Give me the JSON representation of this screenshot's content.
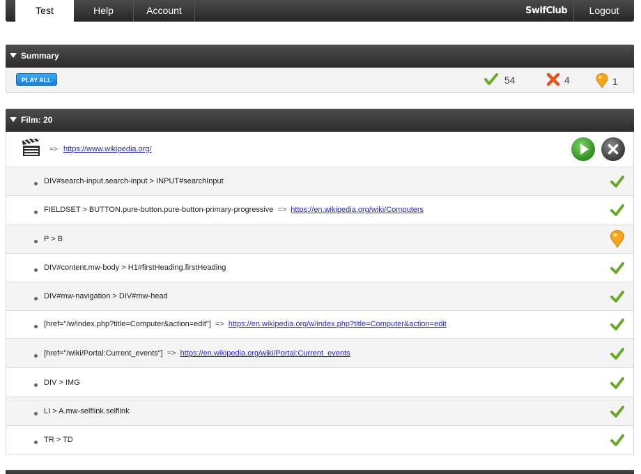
{
  "nav": {
    "tabs": [
      {
        "label": "Test",
        "active": true
      },
      {
        "label": "Help",
        "active": false
      },
      {
        "label": "Account",
        "active": false
      }
    ],
    "brand": "SwifClub",
    "logout": "Logout"
  },
  "summary": {
    "title": "Summary",
    "play_all": "PLAY ALL",
    "passed": "54",
    "failed": "4",
    "warnings": "1"
  },
  "film": {
    "title": "Film: 20",
    "arrow": "=>",
    "url": "https://www.wikipedia.org/",
    "steps": [
      {
        "selector": "DIV#search-input.search-input > INPUT#searchInput",
        "arrow": "",
        "link": "",
        "status": "pass"
      },
      {
        "selector": "FIELDSET > BUTTON.pure-button.pure-button-primary-progressive",
        "arrow": "=>",
        "link": "https://en.wikipedia.org/wiki/Computers",
        "status": "pass"
      },
      {
        "selector": "P > B",
        "arrow": "",
        "link": "",
        "status": "warning"
      },
      {
        "selector": "DIV#content.mw-body > H1#firstHeading.firstHeading",
        "arrow": "",
        "link": "",
        "status": "pass"
      },
      {
        "selector": "DIV#mw-navigation > DIV#mw-head",
        "arrow": "",
        "link": "",
        "status": "pass"
      },
      {
        "selector": "[href=\"/w/index.php?title=Computer&action=edit\"]",
        "arrow": "=>",
        "link": "https://en.wikipedia.org/w/index.php?title=Computer&action=edit",
        "status": "pass"
      },
      {
        "selector": "[href=\"/wiki/Portal:Current_events\"]",
        "arrow": "=>",
        "link": "https://en.wikipedia.org/wiki/Portal:Current_events",
        "status": "pass"
      },
      {
        "selector": "DIV > IMG",
        "arrow": "",
        "link": "",
        "status": "pass"
      },
      {
        "selector": "LI > A.mw-selflink.selflink",
        "arrow": "",
        "link": "",
        "status": "pass"
      },
      {
        "selector": "TR > TD",
        "arrow": "",
        "link": "",
        "status": "pass"
      }
    ]
  },
  "colors": {
    "pass": "#6aa82a",
    "fail": "#e0541e",
    "warning": "#f4a51c",
    "link": "#2a2ab0"
  }
}
